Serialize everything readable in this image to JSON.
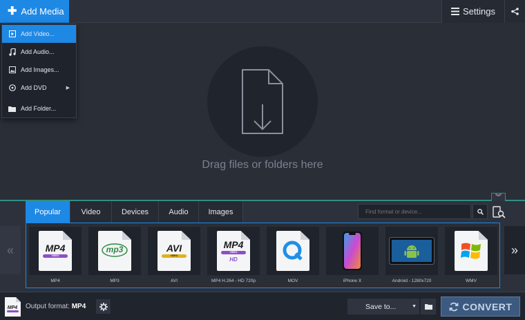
{
  "topbar": {
    "add_media_label": "Add Media",
    "settings_label": "Settings"
  },
  "add_menu": {
    "items": [
      {
        "label": "Add Video...",
        "icon": "video-icon",
        "active": true
      },
      {
        "label": "Add Audio...",
        "icon": "music-note-icon"
      },
      {
        "label": "Add Images...",
        "icon": "image-icon"
      },
      {
        "label": "Add DVD",
        "icon": "disc-icon",
        "submenu": true
      },
      {
        "label": "Add Folder...",
        "icon": "folder-icon"
      }
    ]
  },
  "dropzone": {
    "hint": "Drag files or folders here"
  },
  "formats": {
    "tabs": [
      "Popular",
      "Video",
      "Devices",
      "Audio",
      "Images"
    ],
    "active_tab": "Popular",
    "search_placeholder": "Find format or device...",
    "cards": [
      {
        "label": "MP4",
        "icon": "mp4-file-icon",
        "badge": "MP4",
        "ribbon": "VIDEO"
      },
      {
        "label": "MP3",
        "icon": "mp3-file-icon",
        "badge": "mp3"
      },
      {
        "label": "AVI",
        "icon": "avi-file-icon",
        "badge": "AVI",
        "ribbon": "VIDEO"
      },
      {
        "label": "MP4 H.264 - HD 720p",
        "icon": "mp4-hd-file-icon",
        "badge": "MP4",
        "ribbon": "VIDEO",
        "extra": "HD"
      },
      {
        "label": "MOV",
        "icon": "quicktime-file-icon"
      },
      {
        "label": "iPhone X",
        "icon": "iphone-icon"
      },
      {
        "label": "Android - 1280x720",
        "icon": "android-tablet-icon"
      },
      {
        "label": "WMV",
        "icon": "windows-file-icon"
      }
    ]
  },
  "bottombar": {
    "output_label": "Output format:",
    "output_value": "MP4",
    "save_to_label": "Save to...",
    "convert_label": "CONVERT"
  },
  "colors": {
    "accent": "#1e88e5",
    "teal_divider": "#2f8f85",
    "background": "#2a2e37",
    "convert_disabled": "#3c5a80"
  }
}
